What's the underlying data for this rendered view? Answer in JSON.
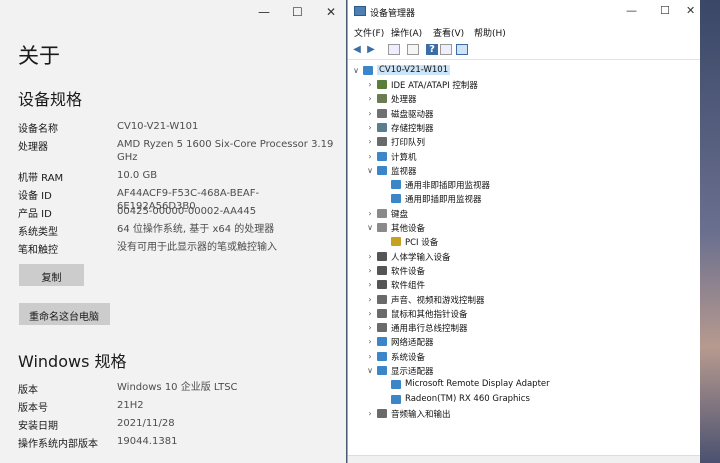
{
  "about": {
    "title": "关于",
    "window_controls": {
      "min": "—",
      "max": "☐",
      "close": "✕"
    },
    "device_spec_heading": "设备规格",
    "specs": [
      {
        "label": "设备名称",
        "value": "CV10-V21-W101"
      },
      {
        "label": "处理器",
        "value": "AMD Ryzen 5 1600 Six-Core Processor 3.19 GHz"
      },
      {
        "label": "机带 RAM",
        "value": "10.0 GB"
      },
      {
        "label": "设备 ID",
        "value": "AF44ACF9-F53C-468A-BEAF-6E192A56D3B0"
      },
      {
        "label": "产品 ID",
        "value": "00425-00000-00002-AA445"
      },
      {
        "label": "系统类型",
        "value": "64 位操作系统, 基于 x64 的处理器"
      },
      {
        "label": "笔和触控",
        "value": "没有可用于此显示器的笔或触控输入"
      }
    ],
    "copy_button": "复制",
    "rename_button": "重命名这台电脑",
    "windows_heading": "Windows 规格",
    "winspecs": [
      {
        "label": "版本",
        "value": "Windows 10 企业版 LTSC"
      },
      {
        "label": "版本号",
        "value": "21H2"
      },
      {
        "label": "安装日期",
        "value": "2021/11/28"
      },
      {
        "label": "操作系统内部版本",
        "value": "19044.1381"
      }
    ]
  },
  "devmgr": {
    "title": "设备管理器",
    "window_controls": {
      "min": "—",
      "max": "☐",
      "close": "✕"
    },
    "menu": [
      "文件(F)",
      "操作(A)",
      "查看(V)",
      "帮助(H)"
    ],
    "root": "CV10-V21-W101",
    "tree": [
      {
        "label": "IDE ATA/ATAPI 控制器",
        "icon": "ide-controller-icon",
        "color": "#5a7d3a",
        "expanded": false,
        "level": 1
      },
      {
        "label": "处理器",
        "icon": "cpu-icon",
        "color": "#6b7b52",
        "expanded": false,
        "level": 1
      },
      {
        "label": "磁盘驱动器",
        "icon": "disk-icon",
        "color": "#707070",
        "expanded": false,
        "level": 1
      },
      {
        "label": "存储控制器",
        "icon": "storage-icon",
        "color": "#5a7d8f",
        "expanded": false,
        "level": 1
      },
      {
        "label": "打印队列",
        "icon": "printer-icon",
        "color": "#6a6a6a",
        "expanded": false,
        "level": 1
      },
      {
        "label": "计算机",
        "icon": "computer-icon",
        "color": "#3a86c8",
        "expanded": false,
        "level": 1
      },
      {
        "label": "监视器",
        "icon": "monitor-icon",
        "color": "#3a86c8",
        "expanded": true,
        "level": 1
      },
      {
        "label": "通用非即插即用监视器",
        "icon": "monitor-icon",
        "color": "#3a86c8",
        "expanded": null,
        "level": 2
      },
      {
        "label": "通用即插即用监视器",
        "icon": "monitor-icon",
        "color": "#3a86c8",
        "expanded": null,
        "level": 2
      },
      {
        "label": "键盘",
        "icon": "keyboard-icon",
        "color": "#8a8a8a",
        "expanded": false,
        "level": 1
      },
      {
        "label": "其他设备",
        "icon": "other-device-icon",
        "color": "#8a8a8a",
        "expanded": true,
        "level": 1
      },
      {
        "label": "PCI 设备",
        "icon": "warning-device-icon",
        "color": "#c8a020",
        "expanded": null,
        "level": 2
      },
      {
        "label": "人体学输入设备",
        "icon": "hid-icon",
        "color": "#555555",
        "expanded": false,
        "level": 1
      },
      {
        "label": "软件设备",
        "icon": "software-device-icon",
        "color": "#555555",
        "expanded": false,
        "level": 1
      },
      {
        "label": "软件组件",
        "icon": "software-component-icon",
        "color": "#555555",
        "expanded": false,
        "level": 1
      },
      {
        "label": "声音、视频和游戏控制器",
        "icon": "sound-icon",
        "color": "#6a6a6a",
        "expanded": false,
        "level": 1
      },
      {
        "label": "鼠标和其他指针设备",
        "icon": "mouse-icon",
        "color": "#6a6a6a",
        "expanded": false,
        "level": 1
      },
      {
        "label": "通用串行总线控制器",
        "icon": "usb-icon",
        "color": "#6a6a6a",
        "expanded": false,
        "level": 1
      },
      {
        "label": "网络适配器",
        "icon": "network-icon",
        "color": "#3a86c8",
        "expanded": false,
        "level": 1
      },
      {
        "label": "系统设备",
        "icon": "system-device-icon",
        "color": "#3a86c8",
        "expanded": false,
        "level": 1
      },
      {
        "label": "显示适配器",
        "icon": "display-adapter-icon",
        "color": "#3a86c8",
        "expanded": true,
        "level": 1
      },
      {
        "label": "Microsoft Remote Display Adapter",
        "icon": "display-adapter-icon",
        "color": "#3a86c8",
        "expanded": null,
        "level": 2
      },
      {
        "label": "Radeon(TM) RX 460 Graphics",
        "icon": "display-adapter-icon",
        "color": "#3a86c8",
        "expanded": null,
        "level": 2
      },
      {
        "label": "音频输入和输出",
        "icon": "audio-icon",
        "color": "#6a6a6a",
        "expanded": false,
        "level": 1
      }
    ]
  },
  "watermark": "知乎 @精锐甲胄骑兵"
}
